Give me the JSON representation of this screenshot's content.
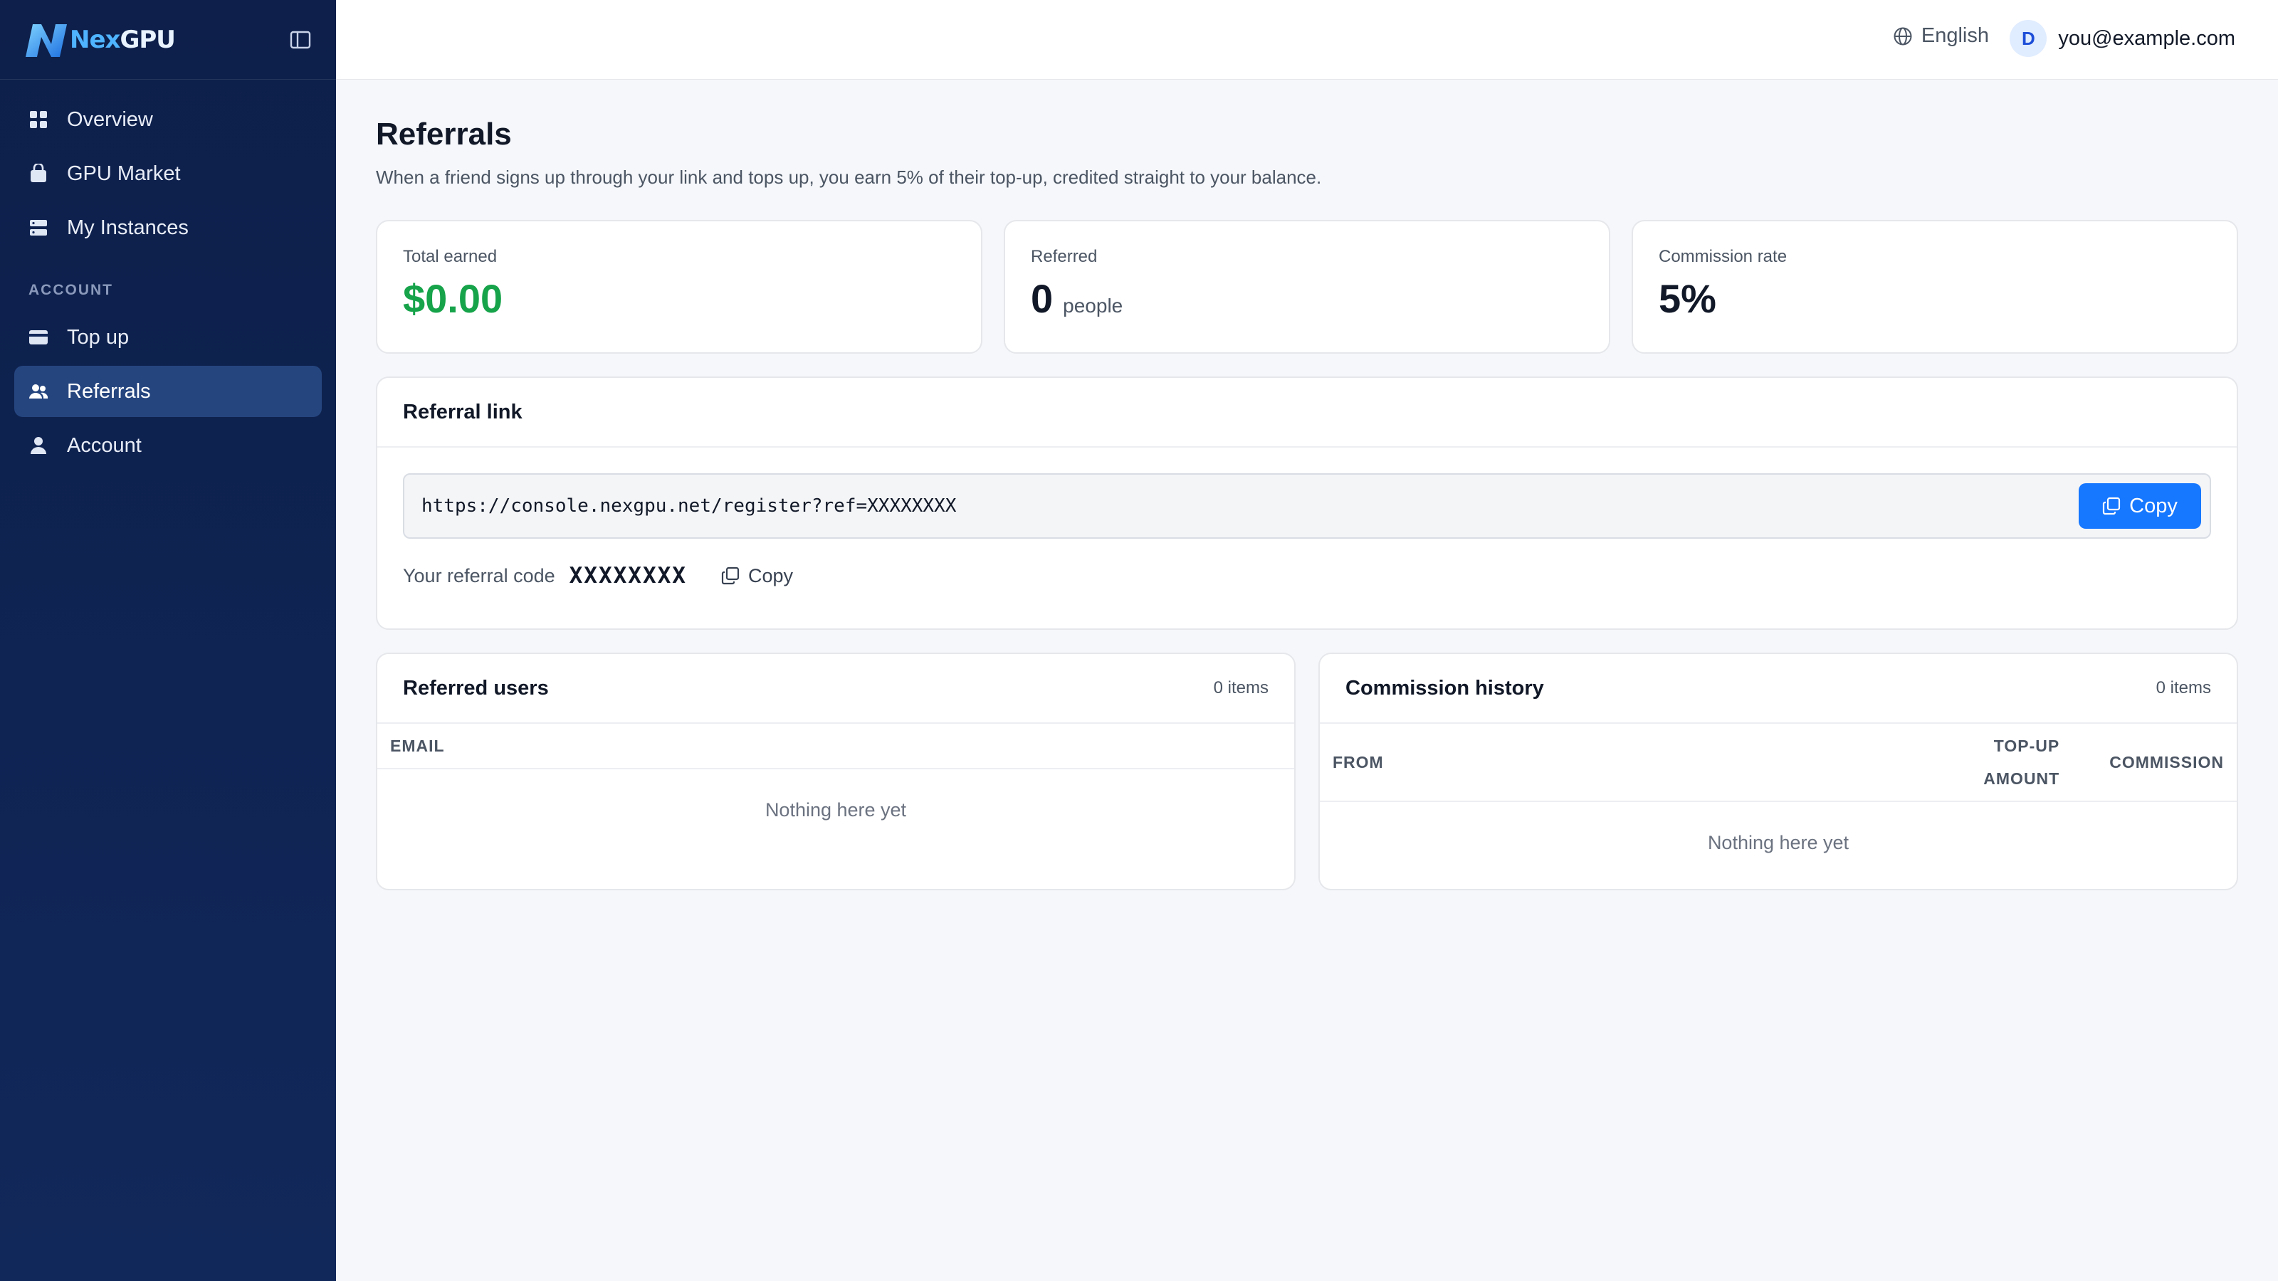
{
  "brand": {
    "name_part1": "Nex",
    "name_part2": "GPU"
  },
  "sidebar": {
    "items": [
      {
        "label": "Overview",
        "icon": "grid-icon"
      },
      {
        "label": "GPU Market",
        "icon": "bag-icon"
      },
      {
        "label": "My Instances",
        "icon": "server-icon"
      }
    ],
    "section_label": "ACCOUNT",
    "account_items": [
      {
        "label": "Top up",
        "icon": "card-icon"
      },
      {
        "label": "Referrals",
        "icon": "users-icon",
        "active": true
      },
      {
        "label": "Account",
        "icon": "user-icon"
      }
    ]
  },
  "header": {
    "language": "English",
    "avatar_initial": "D",
    "email": "you@example.com"
  },
  "page": {
    "title": "Referrals",
    "description": "When a friend signs up through your link and tops up, you earn 5% of their top-up, credited straight to your balance."
  },
  "stats": {
    "total_earned": {
      "label": "Total earned",
      "value": "$0.00"
    },
    "referred": {
      "label": "Referred",
      "value": "0",
      "unit": "people"
    },
    "commission_rate": {
      "label": "Commission rate",
      "value": "5%"
    }
  },
  "referral_link": {
    "title": "Referral link",
    "url": "https://console.nexgpu.net/register?ref=XXXXXXXX",
    "copy_label": "Copy",
    "code_label": "Your referral code",
    "code": "XXXXXXXX",
    "code_copy_label": "Copy"
  },
  "referred_users": {
    "title": "Referred users",
    "count": "0 items",
    "columns": [
      "EMAIL"
    ],
    "empty": "Nothing here yet"
  },
  "commission_history": {
    "title": "Commission history",
    "count": "0 items",
    "columns": [
      "FROM",
      "TOP-UP",
      "AMOUNT",
      "COMMISSION"
    ],
    "empty": "Nothing here yet"
  },
  "colors": {
    "sidebar_bg": "#0d1f4a",
    "active_item": "#25457f",
    "accent": "#1677ff",
    "earned_green": "#16a34a"
  }
}
